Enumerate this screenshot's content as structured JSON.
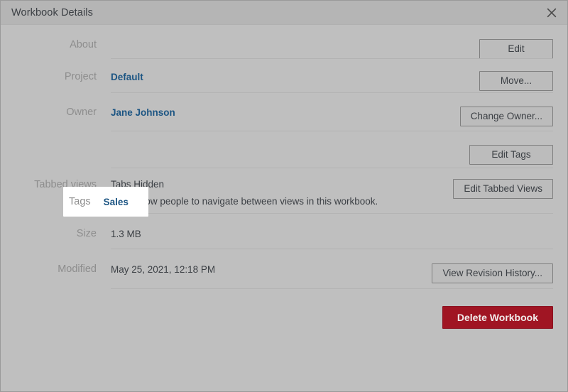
{
  "window": {
    "title": "Workbook Details",
    "close_icon": "close-icon"
  },
  "theme": {
    "background": "#bfbfbf",
    "titlebar": "#b5b5b5",
    "label_color": "#8d8d8d",
    "link_color": "#1c5583",
    "text_color": "#3b3f44",
    "divider": "#b3b3b3",
    "danger_red": "#a01523",
    "highlight_white": "#ffffff"
  },
  "rows": {
    "about": {
      "label": "About",
      "value": "",
      "button": "Edit"
    },
    "project": {
      "label": "Project",
      "value": "Default",
      "button": "Move..."
    },
    "owner": {
      "label": "Owner",
      "value": "Jane Johnson",
      "button": "Change Owner..."
    },
    "tags": {
      "label": "Tags",
      "value": "Sales",
      "button": "Edit Tags",
      "highlighted": true
    },
    "tabbed_views": {
      "label": "Tabbed views",
      "value": "Tabs Hidden",
      "description": "Don't allow people to navigate between views in this workbook.",
      "button": "Edit Tabbed Views"
    },
    "size": {
      "label": "Size",
      "value": "1.3 MB"
    },
    "modified": {
      "label": "Modified",
      "value": "May 25, 2021, 12:18 PM",
      "button": "View Revision History..."
    }
  },
  "footer": {
    "delete_button": "Delete Workbook"
  }
}
